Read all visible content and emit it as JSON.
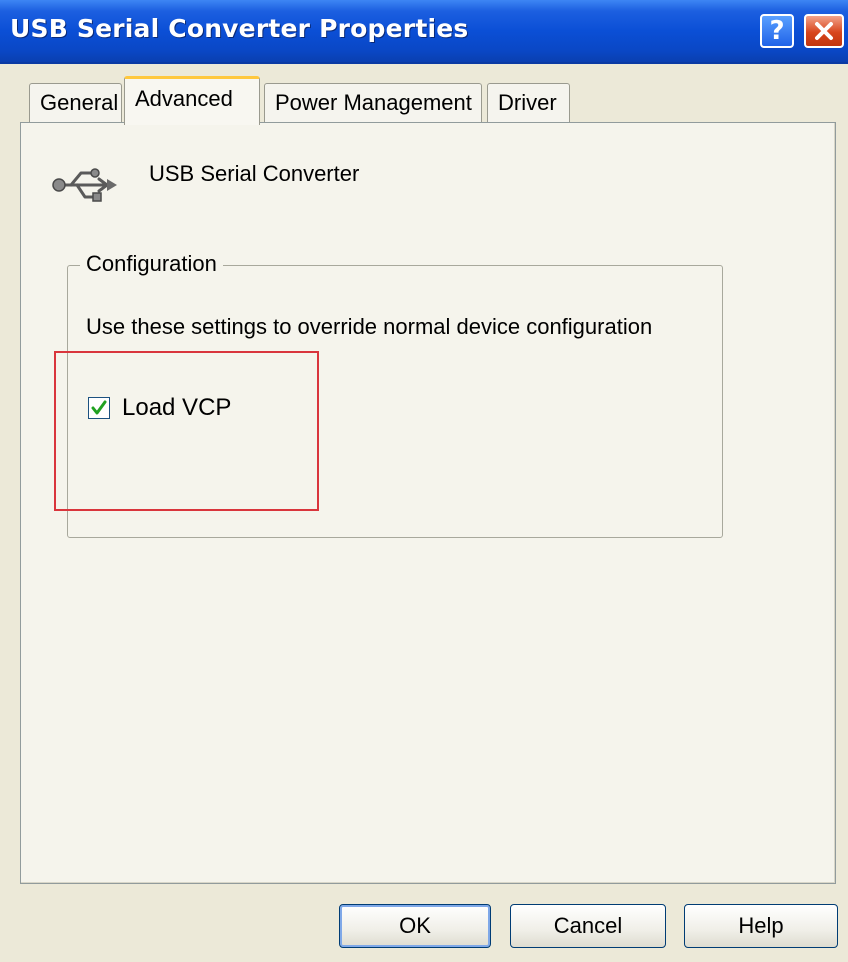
{
  "window": {
    "title": "USB Serial Converter Properties",
    "help_glyph": "?",
    "accent_color": "#0b4fd6",
    "close_color": "#d8451c"
  },
  "tabs": [
    {
      "label": "General",
      "selected": false
    },
    {
      "label": "Advanced",
      "selected": true
    },
    {
      "label": "Power Management",
      "selected": false
    },
    {
      "label": "Driver",
      "selected": false
    }
  ],
  "device": {
    "icon": "usb-icon",
    "name": "USB Serial Converter"
  },
  "configuration": {
    "legend": "Configuration",
    "description": "Use these settings to override normal device configuration",
    "load_vcp": {
      "label": "Load VCP",
      "checked": true
    },
    "highlight_color": "#d9353c"
  },
  "buttons": {
    "ok": "OK",
    "cancel": "Cancel",
    "help": "Help"
  }
}
